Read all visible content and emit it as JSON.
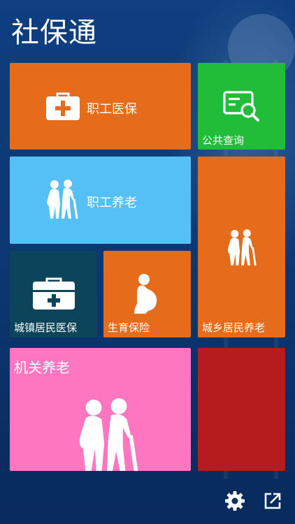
{
  "app": {
    "title": "社保通"
  },
  "tiles": [
    {
      "id": "employee_medical",
      "label": "职工医保",
      "color": "#e46c1b",
      "icon": "first-aid-kit-icon"
    },
    {
      "id": "public_query",
      "label": "公共查询",
      "color": "#1fbd38",
      "icon": "document-search-icon"
    },
    {
      "id": "employee_pension",
      "label": "职工养老",
      "color": "#55c0f5",
      "icon": "elderly-couple-icon"
    },
    {
      "id": "urban_rural_pension",
      "label": "城乡居民养老",
      "color": "#e46c1b",
      "icon": "elderly-couple-icon"
    },
    {
      "id": "urban_resident_medical",
      "label": "城镇居民医保",
      "color": "#0b445b",
      "icon": "medical-kit-icon"
    },
    {
      "id": "maternity_insurance",
      "label": "生育保险",
      "color": "#e46c1b",
      "icon": "pregnant-woman-icon"
    },
    {
      "id": "institution_pension",
      "label": "机关养老",
      "color": "#ff76c0",
      "icon": "elderly-couple-icon"
    },
    {
      "id": "red_tile",
      "label": "",
      "color": "#b61b1e",
      "icon": ""
    }
  ],
  "toolbar": {
    "settings_icon": "gear-icon",
    "share_icon": "share-export-icon"
  }
}
